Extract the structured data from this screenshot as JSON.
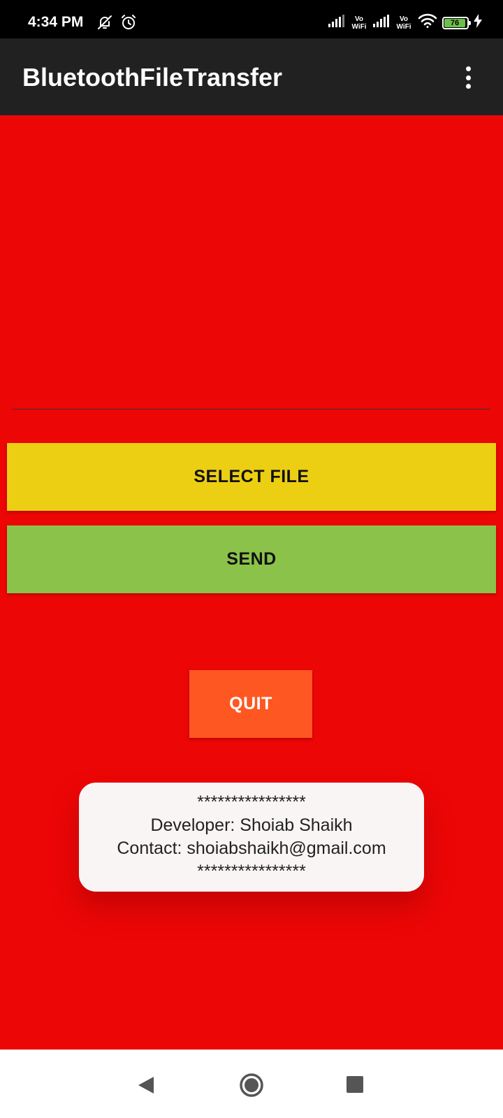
{
  "status_bar": {
    "time": "4:34 PM",
    "left_icons": [
      "notifications-off-icon",
      "alarm-icon"
    ],
    "right_icons": [
      "signal-icon",
      "vowifi-icon",
      "signal-icon",
      "vowifi-icon",
      "wifi-icon",
      "battery-icon",
      "charging-icon"
    ],
    "vowifi_label_top": "Vo",
    "vowifi_label_bottom": "WiFi",
    "battery_level": "76"
  },
  "app_bar": {
    "title": "BluetoothFileTransfer",
    "overflow_icon": "more-vert-icon"
  },
  "buttons": {
    "select_file": "SELECT FILE",
    "send": "SEND",
    "quit": "QUIT"
  },
  "toast": {
    "line1": "****************",
    "line2": "Developer: Shoiab Shaikh",
    "line3": "Contact: shoiabshaikh@gmail.com",
    "line4": "****************"
  },
  "colors": {
    "background": "#ed0606",
    "app_bar": "#212121",
    "select_button": "#eccf12",
    "send_button": "#8bc34a",
    "quit_button": "#ff5722",
    "toast": "#faf5f5"
  },
  "nav_bar": {
    "icons": [
      "back-icon",
      "home-icon",
      "recents-icon"
    ]
  }
}
